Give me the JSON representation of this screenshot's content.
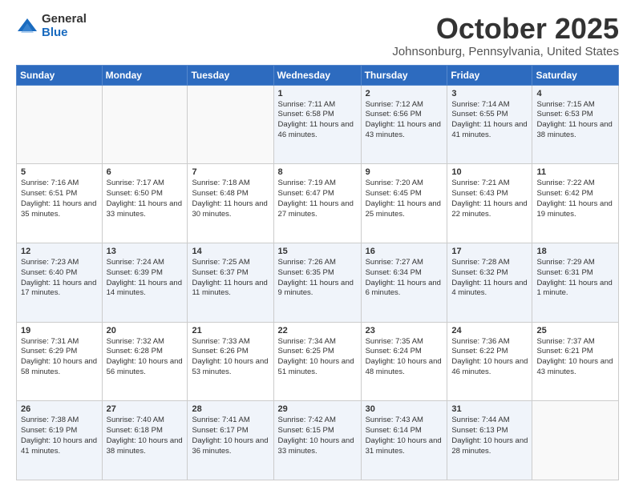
{
  "header": {
    "logo_general": "General",
    "logo_blue": "Blue",
    "month": "October 2025",
    "location": "Johnsonburg, Pennsylvania, United States"
  },
  "days_of_week": [
    "Sunday",
    "Monday",
    "Tuesday",
    "Wednesday",
    "Thursday",
    "Friday",
    "Saturday"
  ],
  "weeks": [
    [
      {
        "day": "",
        "info": ""
      },
      {
        "day": "",
        "info": ""
      },
      {
        "day": "",
        "info": ""
      },
      {
        "day": "1",
        "info": "Sunrise: 7:11 AM\nSunset: 6:58 PM\nDaylight: 11 hours and 46 minutes."
      },
      {
        "day": "2",
        "info": "Sunrise: 7:12 AM\nSunset: 6:56 PM\nDaylight: 11 hours and 43 minutes."
      },
      {
        "day": "3",
        "info": "Sunrise: 7:14 AM\nSunset: 6:55 PM\nDaylight: 11 hours and 41 minutes."
      },
      {
        "day": "4",
        "info": "Sunrise: 7:15 AM\nSunset: 6:53 PM\nDaylight: 11 hours and 38 minutes."
      }
    ],
    [
      {
        "day": "5",
        "info": "Sunrise: 7:16 AM\nSunset: 6:51 PM\nDaylight: 11 hours and 35 minutes."
      },
      {
        "day": "6",
        "info": "Sunrise: 7:17 AM\nSunset: 6:50 PM\nDaylight: 11 hours and 33 minutes."
      },
      {
        "day": "7",
        "info": "Sunrise: 7:18 AM\nSunset: 6:48 PM\nDaylight: 11 hours and 30 minutes."
      },
      {
        "day": "8",
        "info": "Sunrise: 7:19 AM\nSunset: 6:47 PM\nDaylight: 11 hours and 27 minutes."
      },
      {
        "day": "9",
        "info": "Sunrise: 7:20 AM\nSunset: 6:45 PM\nDaylight: 11 hours and 25 minutes."
      },
      {
        "day": "10",
        "info": "Sunrise: 7:21 AM\nSunset: 6:43 PM\nDaylight: 11 hours and 22 minutes."
      },
      {
        "day": "11",
        "info": "Sunrise: 7:22 AM\nSunset: 6:42 PM\nDaylight: 11 hours and 19 minutes."
      }
    ],
    [
      {
        "day": "12",
        "info": "Sunrise: 7:23 AM\nSunset: 6:40 PM\nDaylight: 11 hours and 17 minutes."
      },
      {
        "day": "13",
        "info": "Sunrise: 7:24 AM\nSunset: 6:39 PM\nDaylight: 11 hours and 14 minutes."
      },
      {
        "day": "14",
        "info": "Sunrise: 7:25 AM\nSunset: 6:37 PM\nDaylight: 11 hours and 11 minutes."
      },
      {
        "day": "15",
        "info": "Sunrise: 7:26 AM\nSunset: 6:35 PM\nDaylight: 11 hours and 9 minutes."
      },
      {
        "day": "16",
        "info": "Sunrise: 7:27 AM\nSunset: 6:34 PM\nDaylight: 11 hours and 6 minutes."
      },
      {
        "day": "17",
        "info": "Sunrise: 7:28 AM\nSunset: 6:32 PM\nDaylight: 11 hours and 4 minutes."
      },
      {
        "day": "18",
        "info": "Sunrise: 7:29 AM\nSunset: 6:31 PM\nDaylight: 11 hours and 1 minute."
      }
    ],
    [
      {
        "day": "19",
        "info": "Sunrise: 7:31 AM\nSunset: 6:29 PM\nDaylight: 10 hours and 58 minutes."
      },
      {
        "day": "20",
        "info": "Sunrise: 7:32 AM\nSunset: 6:28 PM\nDaylight: 10 hours and 56 minutes."
      },
      {
        "day": "21",
        "info": "Sunrise: 7:33 AM\nSunset: 6:26 PM\nDaylight: 10 hours and 53 minutes."
      },
      {
        "day": "22",
        "info": "Sunrise: 7:34 AM\nSunset: 6:25 PM\nDaylight: 10 hours and 51 minutes."
      },
      {
        "day": "23",
        "info": "Sunrise: 7:35 AM\nSunset: 6:24 PM\nDaylight: 10 hours and 48 minutes."
      },
      {
        "day": "24",
        "info": "Sunrise: 7:36 AM\nSunset: 6:22 PM\nDaylight: 10 hours and 46 minutes."
      },
      {
        "day": "25",
        "info": "Sunrise: 7:37 AM\nSunset: 6:21 PM\nDaylight: 10 hours and 43 minutes."
      }
    ],
    [
      {
        "day": "26",
        "info": "Sunrise: 7:38 AM\nSunset: 6:19 PM\nDaylight: 10 hours and 41 minutes."
      },
      {
        "day": "27",
        "info": "Sunrise: 7:40 AM\nSunset: 6:18 PM\nDaylight: 10 hours and 38 minutes."
      },
      {
        "day": "28",
        "info": "Sunrise: 7:41 AM\nSunset: 6:17 PM\nDaylight: 10 hours and 36 minutes."
      },
      {
        "day": "29",
        "info": "Sunrise: 7:42 AM\nSunset: 6:15 PM\nDaylight: 10 hours and 33 minutes."
      },
      {
        "day": "30",
        "info": "Sunrise: 7:43 AM\nSunset: 6:14 PM\nDaylight: 10 hours and 31 minutes."
      },
      {
        "day": "31",
        "info": "Sunrise: 7:44 AM\nSunset: 6:13 PM\nDaylight: 10 hours and 28 minutes."
      },
      {
        "day": "",
        "info": ""
      }
    ]
  ]
}
